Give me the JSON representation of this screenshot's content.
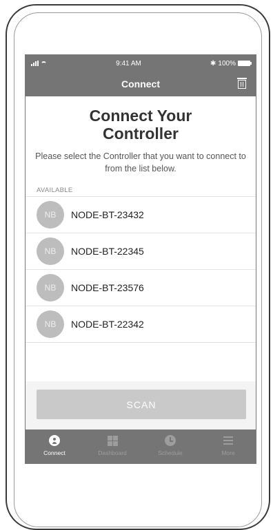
{
  "status_bar": {
    "time": "9:41 AM",
    "battery": "100%"
  },
  "nav": {
    "title": "Connect",
    "right_icon": "trash-icon"
  },
  "header": {
    "title": "Connect Your Controller",
    "subtitle": "Please select the Controller that you want to connect to from the list below."
  },
  "section": {
    "label": "AVAILABLE"
  },
  "devices": [
    {
      "avatar": "NB",
      "name": "NODE-BT-23432"
    },
    {
      "avatar": "NB",
      "name": "NODE-BT-22345"
    },
    {
      "avatar": "NB",
      "name": "NODE-BT-23576"
    },
    {
      "avatar": "NB",
      "name": "NODE-BT-22342"
    }
  ],
  "scan_button": {
    "label": "SCAN"
  },
  "tabs": [
    {
      "label": "Connect",
      "icon": "connect-icon",
      "active": true
    },
    {
      "label": "Dashboard",
      "icon": "dashboard-icon",
      "active": false
    },
    {
      "label": "Schedule",
      "icon": "schedule-icon",
      "active": false
    },
    {
      "label": "More",
      "icon": "more-icon",
      "active": false
    }
  ],
  "colors": {
    "bar": "#757575",
    "avatar": "#bdbdbd",
    "button_disabled": "#c9c9c9"
  }
}
